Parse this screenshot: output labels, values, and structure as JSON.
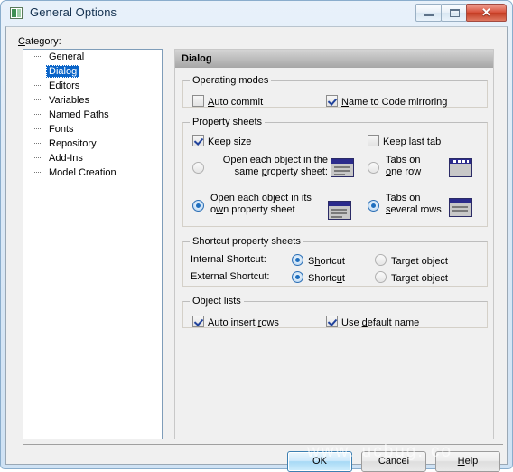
{
  "window": {
    "title": "General Options",
    "icon": "window-icon",
    "controls": {
      "minimize": "minimize-icon",
      "maximize": "maximize-icon",
      "close": "✕"
    }
  },
  "category": {
    "label": "Category:",
    "items": [
      {
        "label": "General",
        "selected": false
      },
      {
        "label": "Dialog",
        "selected": true
      },
      {
        "label": "Editors",
        "selected": false
      },
      {
        "label": "Variables",
        "selected": false
      },
      {
        "label": "Named Paths",
        "selected": false
      },
      {
        "label": "Fonts",
        "selected": false
      },
      {
        "label": "Repository",
        "selected": false
      },
      {
        "label": "Add-Ins",
        "selected": false
      },
      {
        "label": "Model Creation",
        "selected": false
      }
    ]
  },
  "panel": {
    "header": "Dialog",
    "operating_modes": {
      "legend": "Operating modes",
      "auto_commit": {
        "label": "Auto commit",
        "accel": "A",
        "checked": false
      },
      "name_to_code": {
        "label": "Name to Code mirroring",
        "accel": "N",
        "checked": true
      }
    },
    "property_sheets": {
      "legend": "Property sheets",
      "keep_size": {
        "label": "Keep size",
        "accel": "z",
        "checked": true
      },
      "keep_last_tab": {
        "label": "Keep last tab",
        "accel": "t",
        "checked": false
      },
      "same_sheet": {
        "line1": "Open each object in the",
        "line2": "same property sheet:",
        "accel": "p",
        "selected": false,
        "icon": "single-window-icon"
      },
      "own_sheet": {
        "line1": "Open each object in its",
        "line2": "own property sheet",
        "accel": "w",
        "selected": true,
        "icon": "stacked-windows-icon"
      },
      "tabs_one_row": {
        "line1": "Tabs on",
        "line2": "one row",
        "accel": "o",
        "selected": false,
        "icon": "tabs-one-row-icon"
      },
      "tabs_several_rows": {
        "line1": "Tabs on",
        "line2": "several rows",
        "accel": "s",
        "selected": true,
        "icon": "tabs-several-rows-icon"
      }
    },
    "shortcut_sheets": {
      "legend": "Shortcut property sheets",
      "internal": {
        "label": "Internal Shortcut:",
        "option_shortcut": {
          "label": "Shortcut",
          "accel": "h",
          "selected": true
        },
        "option_target": {
          "label": "Target object",
          "accel": "g",
          "selected": false
        }
      },
      "external": {
        "label": "External Shortcut:",
        "option_shortcut": {
          "label": "Shortcut",
          "accel": "u",
          "selected": true
        },
        "option_target": {
          "label": "Target object",
          "accel": "g",
          "selected": false
        }
      }
    },
    "object_lists": {
      "legend": "Object lists",
      "auto_insert_rows": {
        "label": "Auto insert rows",
        "accel": "r",
        "checked": true
      },
      "use_default_name": {
        "label": "Use default name",
        "accel": "d",
        "checked": true
      }
    }
  },
  "buttons": {
    "ok": "OK",
    "cancel": "Cancel",
    "help": "Help"
  },
  "watermark": "www. ucbug. co",
  "colors": {
    "selection": "#0a64c8",
    "accent": "#2b2b8c",
    "close_button": "#c33c23"
  }
}
